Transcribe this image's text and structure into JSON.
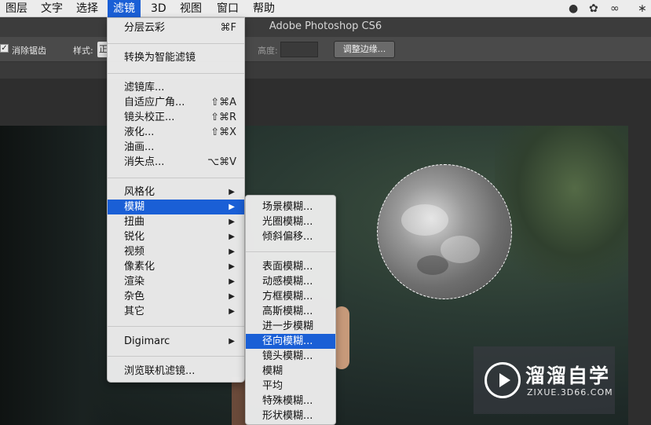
{
  "menubar": {
    "items": [
      "图层",
      "文字",
      "选择",
      "滤镜",
      "3D",
      "视图",
      "窗口",
      "帮助"
    ],
    "active": "滤镜"
  },
  "window": {
    "title": "Adobe Photoshop CS6"
  },
  "options_bar": {
    "antialias_label": "消除锯齿",
    "antialias_checked": true,
    "style_label": "样式:",
    "style_value": "正",
    "height_label": "高度:",
    "refine_button": "调整边缘..."
  },
  "filter_menu": {
    "items": [
      {
        "label": "分层云彩",
        "shortcut": "⌘F"
      },
      {
        "label": "转换为智能滤镜"
      },
      {
        "label": "滤镜库..."
      },
      {
        "label": "自适应广角...",
        "shortcut": "⇧⌘A"
      },
      {
        "label": "镜头校正...",
        "shortcut": "⇧⌘R"
      },
      {
        "label": "液化...",
        "shortcut": "⇧⌘X"
      },
      {
        "label": "油画..."
      },
      {
        "label": "消失点...",
        "shortcut": "⌥⌘V"
      },
      {
        "label": "风格化",
        "submenu": true
      },
      {
        "label": "模糊",
        "submenu": true,
        "highlighted": true
      },
      {
        "label": "扭曲",
        "submenu": true
      },
      {
        "label": "锐化",
        "submenu": true
      },
      {
        "label": "视频",
        "submenu": true
      },
      {
        "label": "像素化",
        "submenu": true
      },
      {
        "label": "渲染",
        "submenu": true
      },
      {
        "label": "杂色",
        "submenu": true
      },
      {
        "label": "其它",
        "submenu": true
      },
      {
        "label": "Digimarc",
        "submenu": true
      },
      {
        "label": "浏览联机滤镜..."
      }
    ]
  },
  "blur_submenu": {
    "items": [
      {
        "label": "场景模糊..."
      },
      {
        "label": "光圈模糊..."
      },
      {
        "label": "倾斜偏移..."
      },
      {
        "label": "表面模糊..."
      },
      {
        "label": "动感模糊..."
      },
      {
        "label": "方框模糊..."
      },
      {
        "label": "高斯模糊..."
      },
      {
        "label": "进一步模糊"
      },
      {
        "label": "径向模糊...",
        "highlighted": true
      },
      {
        "label": "镜头模糊..."
      },
      {
        "label": "模糊"
      },
      {
        "label": "平均"
      },
      {
        "label": "特殊模糊..."
      },
      {
        "label": "形状模糊..."
      }
    ]
  },
  "watermark": {
    "name": "溜溜自学",
    "url": "ZIXUE.3D66.COM"
  },
  "colors": {
    "highlight": "#1a5fd6",
    "menubar_bg": "#ececec",
    "options_bg": "#4a4a4a"
  }
}
